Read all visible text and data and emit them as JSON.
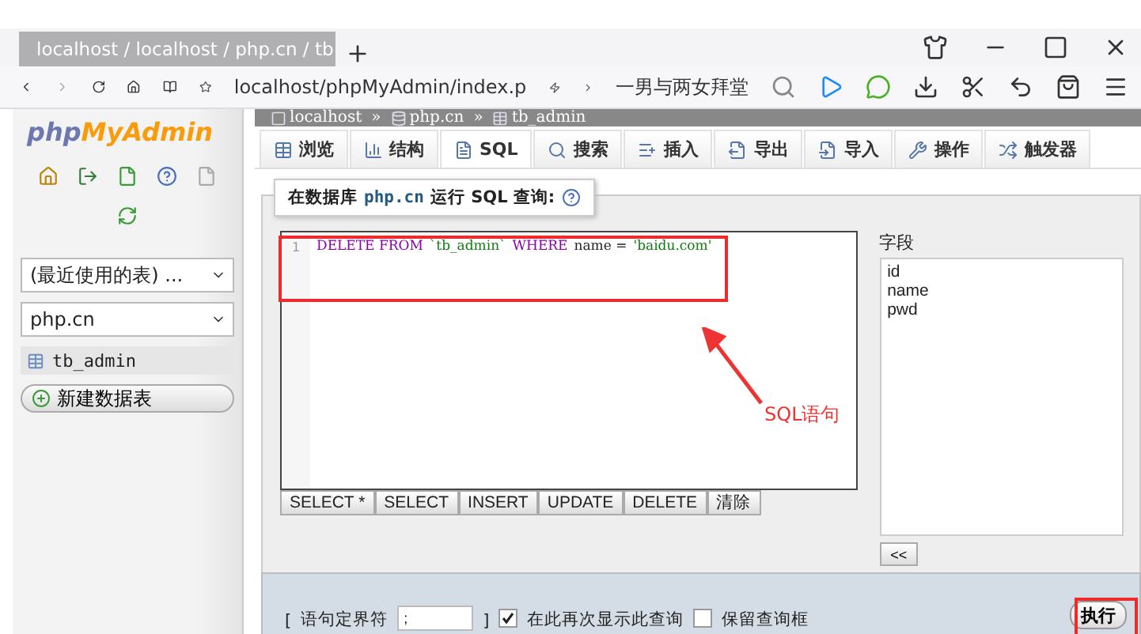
{
  "browser": {
    "tab_title": "localhost / localhost / php.cn / tb",
    "address": "localhost/phpMyAdmin/index.p",
    "search_text": "一男与两女拜堂"
  },
  "sidebar": {
    "logo": [
      "php",
      "MyAdmin"
    ],
    "selects": [
      "(最近使用的表) ...",
      "php.cn"
    ],
    "tables": [
      {
        "name": "tb_admin"
      }
    ],
    "new_table": "新建数据表"
  },
  "breadcrumb": {
    "separator": "»",
    "items": [
      "localhost",
      "php.cn",
      "tb_admin"
    ]
  },
  "tabs": [
    {
      "label": "浏览",
      "selected": false
    },
    {
      "label": "结构",
      "selected": false
    },
    {
      "label": "SQL",
      "selected": true
    },
    {
      "label": "搜索",
      "selected": false
    },
    {
      "label": "插入",
      "selected": false
    },
    {
      "label": "导出",
      "selected": false
    },
    {
      "label": "导入",
      "selected": false
    },
    {
      "label": "操作",
      "selected": false
    },
    {
      "label": "触发器",
      "selected": false
    }
  ],
  "query": {
    "legend": [
      "在数据库",
      "php.cn",
      "运行 SQL 查询:"
    ],
    "line_numbers": [
      "1"
    ],
    "code": [
      {
        "text": "DELETE FROM",
        "kind": "keyword"
      },
      {
        "text": "`tb_admin`",
        "kind": "identifier"
      },
      {
        "text": "WHERE",
        "kind": "keyword"
      },
      {
        "text": "name =",
        "kind": "plain"
      },
      {
        "text": "'baidu.com'",
        "kind": "string"
      }
    ],
    "buttons": [
      "SELECT *",
      "SELECT",
      "INSERT",
      "UPDATE",
      "DELETE",
      "清除"
    ],
    "fields_label": "字段",
    "fields": [
      "id",
      "name",
      "pwd"
    ],
    "insert_button": "<<"
  },
  "options": {
    "open_bracket": "[",
    "delimiter_label": "语句定界符",
    "delimiter": ";",
    "close_bracket": "]",
    "checks": [
      {
        "label": "在此再次显示此查询",
        "checked": true
      },
      {
        "label": "保留查询框",
        "checked": false
      }
    ],
    "go": "执行"
  },
  "annotation": "SQL语句"
}
